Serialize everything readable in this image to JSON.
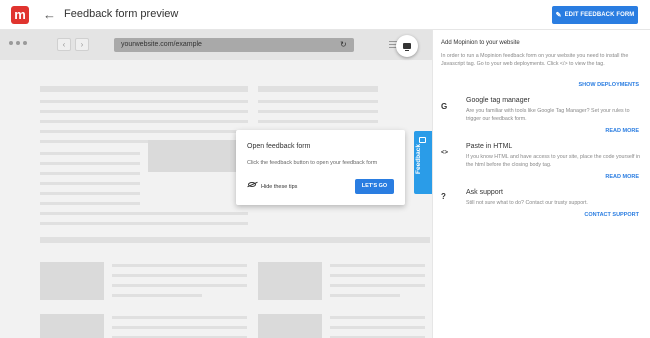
{
  "header": {
    "logo_letter": "m",
    "back_glyph": "←",
    "title": "Feedback form preview",
    "edit_button": "EDIT FEEDBACK FORM",
    "brand_color": "#e0342f",
    "accent_color": "#2a7de1"
  },
  "browser": {
    "back_glyph": "‹",
    "forward_glyph": "›",
    "url": "yourwebsite.com/example",
    "reload_glyph": "↻"
  },
  "tip": {
    "title": "Open feedback form",
    "text": "Click the feedback button to open your feedback form",
    "hide_label": "Hide these tips",
    "action_label": "LET'S GO"
  },
  "feedback_tab": {
    "label": "Feedback",
    "color": "#2a9ce8"
  },
  "sidebar": {
    "heading": "Add Mopinion to your website",
    "intro": "In order to run a Mopinion feedback form on your website you need to install the Javascript tag. Go to your web deployments. Click </> to view the tag.",
    "intro_link": "SHOW DEPLOYMENTS",
    "sections": [
      {
        "icon": "G",
        "title": "Google tag manager",
        "text": "Are you familiar with tools like Google Tag Manager? Set your rules to trigger our feedback form.",
        "link": "READ MORE"
      },
      {
        "icon": "<>",
        "title": "Paste in HTML",
        "text": "If you know HTML and have access to your site, place the code yourself in the html before the closing body tag.",
        "link": "READ MORE"
      },
      {
        "icon": "?",
        "title": "Ask support",
        "text": "Still not sure what to do? Contact our trusty support.",
        "link": "CONTACT SUPPORT"
      }
    ]
  }
}
